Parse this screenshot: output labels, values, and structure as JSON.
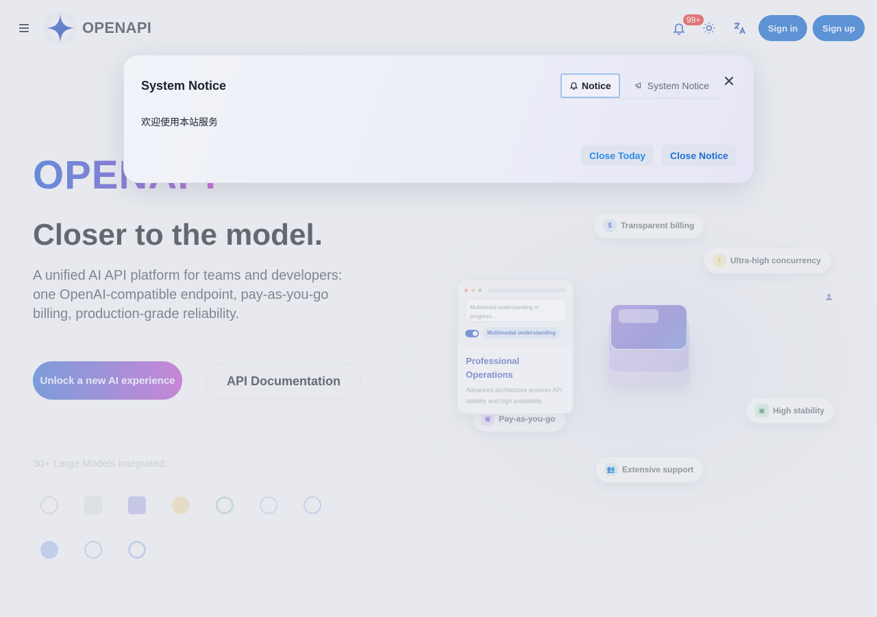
{
  "header": {
    "brand": "OPENAPI",
    "notification_badge": "99+",
    "signin_label": "Sign in",
    "signup_label": "Sign up",
    "icons": [
      "menu-icon",
      "logo-star-icon",
      "bell-icon",
      "sun-icon",
      "translate-icon"
    ]
  },
  "hero": {
    "brand_big": "OPENAPI",
    "title": "Closer to the model.",
    "subtitle": "A unified AI API platform for teams and developers: one OpenAI-compatible endpoint, pay-as-you-go billing, production-grade reliability.",
    "cta_primary": "Unlock a new AI experience",
    "cta_secondary": "API Documentation",
    "models_caption": "30+ Large Models Integrated"
  },
  "illustration": {
    "chips": {
      "transparent_billing": "Transparent billing",
      "concurrency": "Ultra-high concurrency",
      "high_stability": "High stability",
      "pay_as_you_go": "Pay-as-you-go",
      "extensive_support": "Extensive support"
    },
    "card": {
      "input_text": "Multimodal understanding in progress...",
      "tag": "Multimodal understanding",
      "heading": "Professional Operations",
      "description": "Advanced architecture ensures API stability and high availability."
    }
  },
  "modal": {
    "title": "System Notice",
    "tabs": [
      "Notice",
      "System Notice"
    ],
    "active_tab": "Notice",
    "body": "欢迎使用本站服务",
    "close_today_label": "Close Today",
    "close_notice_label": "Close Notice"
  },
  "colors": {
    "primary": "#1f6fd1",
    "badge": "#e5453d",
    "accent_link": "#2b8be6"
  }
}
